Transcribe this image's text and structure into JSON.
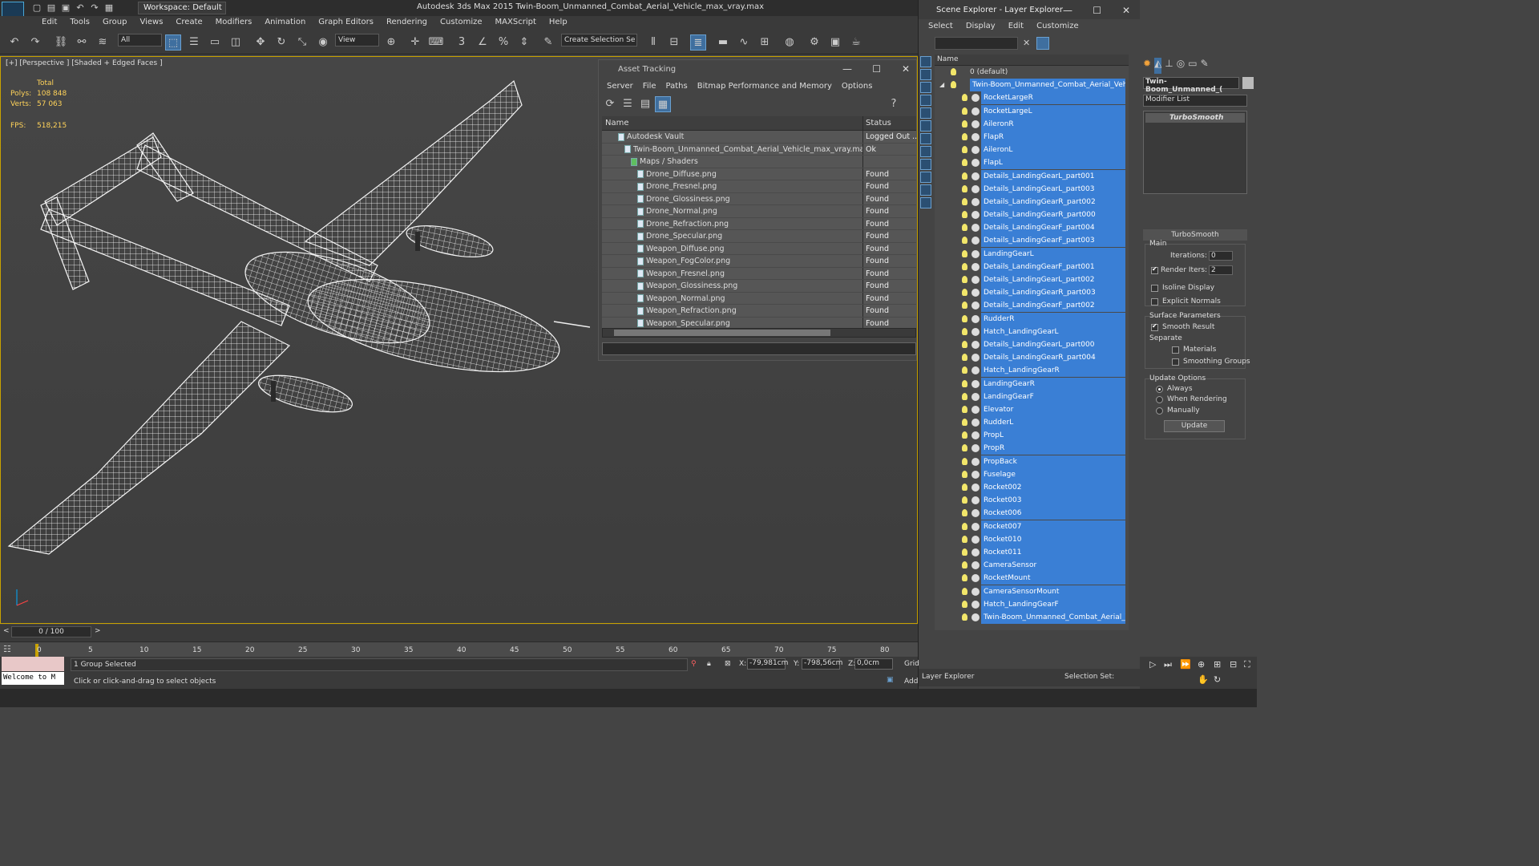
{
  "app": {
    "logo": "MAX",
    "workspace": "Workspace: Default",
    "title": "Autodesk 3ds Max 2015    Twin-Boom_Unmanned_Combat_Aerial_Vehicle_max_vray.max"
  },
  "menu": [
    "Edit",
    "Tools",
    "Group",
    "Views",
    "Create",
    "Modifiers",
    "Animation",
    "Graph Editors",
    "Rendering",
    "Customize",
    "MAXScript",
    "Help"
  ],
  "toolbar": {
    "selection_filter": "All",
    "ref_coord": "View",
    "selection_set": "Create Selection Se"
  },
  "viewport": {
    "label": "[+] [Perspective ] [Shaded + Edged Faces ]",
    "stats": {
      "total": "Total",
      "polys_label": "Polys:",
      "polys": "108 848",
      "verts_label": "Verts:",
      "verts": "57 063",
      "fps_label": "FPS:",
      "fps": "518,215"
    }
  },
  "asset_tracking": {
    "title": "Asset Tracking",
    "menu": [
      "Server",
      "File",
      "Paths",
      "Bitmap Performance and Memory",
      "Options"
    ],
    "col_name": "Name",
    "col_status": "Status",
    "rows": [
      {
        "name": "Autodesk Vault",
        "status": "Logged Out ...",
        "indent": 2
      },
      {
        "name": "Twin-Boom_Unmanned_Combat_Aerial_Vehicle_max_vray.max",
        "status": "Ok",
        "indent": 3
      },
      {
        "name": "Maps / Shaders",
        "status": "",
        "indent": 4
      },
      {
        "name": "Drone_Diffuse.png",
        "status": "Found",
        "indent": 5
      },
      {
        "name": "Drone_Fresnel.png",
        "status": "Found",
        "indent": 5
      },
      {
        "name": "Drone_Glossiness.png",
        "status": "Found",
        "indent": 5
      },
      {
        "name": "Drone_Normal.png",
        "status": "Found",
        "indent": 5
      },
      {
        "name": "Drone_Refraction.png",
        "status": "Found",
        "indent": 5
      },
      {
        "name": "Drone_Specular.png",
        "status": "Found",
        "indent": 5
      },
      {
        "name": "Weapon_Diffuse.png",
        "status": "Found",
        "indent": 5
      },
      {
        "name": "Weapon_FogColor.png",
        "status": "Found",
        "indent": 5
      },
      {
        "name": "Weapon_Fresnel.png",
        "status": "Found",
        "indent": 5
      },
      {
        "name": "Weapon_Glossiness.png",
        "status": "Found",
        "indent": 5
      },
      {
        "name": "Weapon_Normal.png",
        "status": "Found",
        "indent": 5
      },
      {
        "name": "Weapon_Refraction.png",
        "status": "Found",
        "indent": 5
      },
      {
        "name": "Weapon_Specular.png",
        "status": "Found",
        "indent": 5
      }
    ]
  },
  "scene_explorer": {
    "title": "Scene Explorer - Layer Explorer",
    "menu": [
      "Select",
      "Display",
      "Edit",
      "Customize"
    ],
    "col_name": "Name",
    "layer_default": "0 (default)",
    "layer_main": "Twin-Boom_Unmanned_Combat_Aerial_Vehicle",
    "objects": [
      "RocketLargeR",
      "RocketLargeL",
      "AileronR",
      "FlapR",
      "AileronL",
      "FlapL",
      "Details_LandingGearL_part001",
      "Details_LandingGearL_part003",
      "Details_LandingGearR_part002",
      "Details_LandingGearR_part000",
      "Details_LandingGearF_part004",
      "Details_LandingGearF_part003",
      "LandingGearL",
      "Details_LandingGearF_part001",
      "Details_LandingGearL_part002",
      "Details_LandingGearR_part003",
      "Details_LandingGearF_part002",
      "RudderR",
      "Hatch_LandingGearL",
      "Details_LandingGearL_part000",
      "Details_LandingGearR_part004",
      "Hatch_LandingGearR",
      "LandingGearR",
      "LandingGearF",
      "Elevator",
      "RudderL",
      "PropL",
      "PropR",
      "PropBack",
      "Fuselage",
      "Rocket002",
      "Rocket003",
      "Rocket006",
      "Rocket007",
      "Rocket010",
      "Rocket011",
      "CameraSensor",
      "RocketMount",
      "CameraSensorMount",
      "Hatch_LandingGearF",
      "Twin-Boom_Unmanned_Combat_Aerial_Ve..."
    ],
    "footer_label": "Layer Explorer",
    "selection_set": "Selection Set:"
  },
  "command_panel": {
    "object_name": "Twin-Boom_Unmanned_(",
    "modifier_list": "Modifier List",
    "modifier": "TurboSmooth",
    "rollout": "TurboSmooth",
    "main": "Main",
    "iterations_label": "Iterations:",
    "iterations": "0",
    "render_iters_label": "Render Iters:",
    "render_iters": "2",
    "isoline": "Isoline Display",
    "explicit": "Explicit Normals",
    "surface": "Surface Parameters",
    "smooth_result": "Smooth Result",
    "separate": "Separate",
    "materials": "Materials",
    "smoothing_groups": "Smoothing Groups",
    "update_options": "Update Options",
    "always": "Always",
    "when_rendering": "When Rendering",
    "manually": "Manually",
    "update": "Update"
  },
  "timeline": {
    "frame": "0 / 100",
    "ticks": [
      "0",
      "5",
      "10",
      "15",
      "20",
      "25",
      "30",
      "35",
      "40",
      "45",
      "50",
      "55",
      "60",
      "65",
      "70",
      "75",
      "80"
    ]
  },
  "status": {
    "script_listener": "Welcome to M",
    "selected": "1 Group Selected",
    "prompt": "Click or click-and-drag to select objects",
    "x_label": "X:",
    "x": "-79,981cm",
    "y_label": "Y:",
    "y": "-798,56cm",
    "z_label": "Z:",
    "z": "0,0cm",
    "grid": "Grid",
    "add": "Add"
  },
  "colors": {
    "selection": "#3a7fd5",
    "viewport_border": "#c8a200",
    "stats": "#ffd35a"
  }
}
